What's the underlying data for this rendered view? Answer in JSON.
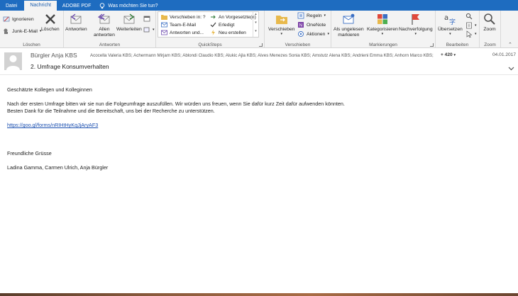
{
  "tabs": [
    {
      "label": "Datei"
    },
    {
      "label": "Nachricht"
    },
    {
      "label": "ADOBE PDF"
    }
  ],
  "tellme": "Was möchten Sie tun?",
  "ribbon": {
    "loeschen": {
      "label": "Löschen",
      "ignorieren": "Ignorieren",
      "junk": "Junk-E-Mail",
      "delete": "Löschen"
    },
    "antworten": {
      "label": "Antworten",
      "reply": "Antworten",
      "reply_all_1": "Allen",
      "reply_all_2": "antworten",
      "forward": "Weiterleiten"
    },
    "quicksteps": {
      "label": "QuickSteps",
      "items": [
        "Verschieben in: ?",
        "Team-E-Mail",
        "Antworten und...",
        "An Vorgesetzte(n)",
        "Erledigt",
        "Neu erstellen"
      ]
    },
    "verschieben": {
      "label": "Verschieben",
      "move": "Verschieben",
      "rules": "Regeln",
      "onenote": "OneNote",
      "actions": "Aktionen"
    },
    "markierungen": {
      "label": "Markierungen",
      "unread_1": "Als ungelesen",
      "unread_2": "markieren",
      "categorize": "Kategorisieren",
      "followup": "Nachverfolgung"
    },
    "bearbeiten": {
      "label": "Bearbeiten",
      "translate": "Übersetzen"
    },
    "zoom": {
      "label": "Zoom",
      "zoom": "Zoom"
    }
  },
  "message": {
    "sender": "Bürgler Anja KBS",
    "recipients": "Acocella Valeria KBS; Achermann Mirjam KBS; Ablondi Claudio KBS; Alukic Ajla KBS; Alves Menezes Sonia KBS; Amstutz Alena KBS; Andrieni Emma KBS; Anhorn Marco KBS;",
    "recipient_count": "+ 420",
    "date": "04.01.2017",
    "subject": "2. Umfrage Konsumverhalten"
  },
  "body": {
    "greeting": "Geschätzte Kollegen und Kolleginnen",
    "line1": "Nach der ersten Umfrage bitten wir sie nun die Folgeumfrage auszufüllen. Wir würden uns freuen, wenn Sie dafür kurz Zeit dafür aufwenden könnten.",
    "line2": "Besten Dank für die Teilnahme und die Bereitschaft, uns bei der Recherche zu unterstützen.",
    "link": "https://goo.gl/forms/nRIHtHyKqJjAryAF3",
    "closing": "Freundliche Grüsse",
    "signature": "Ladina Gamma, Carmen Ulrich, Anja Bürgler"
  },
  "colors": {
    "accent": "#1e6cc0",
    "link": "#1a4fb0",
    "flag": "#e0483a"
  }
}
